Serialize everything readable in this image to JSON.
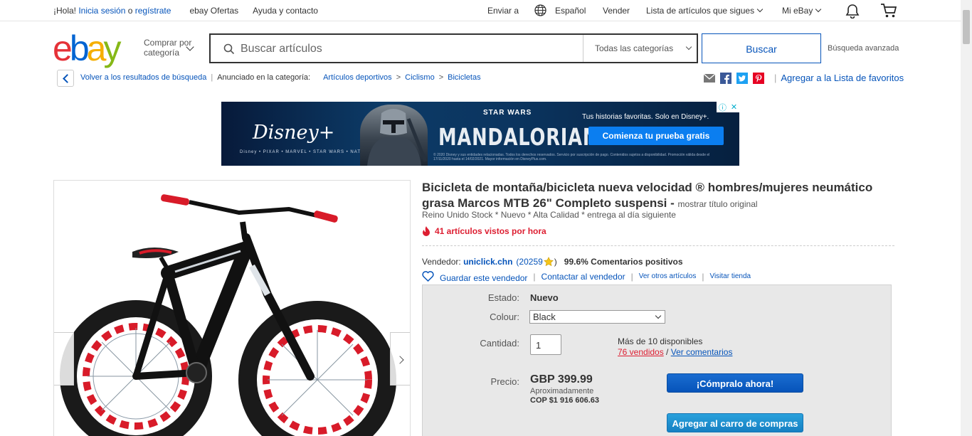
{
  "topbar": {
    "greeting": "¡Hola! ",
    "signin": "Inicia sesión",
    "or": " o ",
    "register": "regístrate",
    "deals": "ebay Ofertas",
    "help": "Ayuda y contacto",
    "ship_to": "Enviar a",
    "language": "Español",
    "sell": "Vender",
    "watchlist": "Lista de artículos que sigues",
    "my_ebay": "Mi eBay"
  },
  "header": {
    "logo": [
      "e",
      "b",
      "a",
      "y"
    ],
    "shop_by_category": [
      "Comprar por",
      "categoría"
    ],
    "search_placeholder": "Buscar artículos",
    "category_select": "Todas las categorías",
    "search_button": "Buscar",
    "advanced": "Búsqueda avanzada"
  },
  "breadcrumb": {
    "back": "Volver a los resultados de búsqueda",
    "listed_in": "Anunciado en la categoría:",
    "items": [
      "Artículos deportivos",
      "Ciclismo",
      "Bicicletas"
    ],
    "add_to_watchlist": "Agregar a la Lista de favoritos"
  },
  "ad": {
    "brand": "Disney+",
    "brands_line": "Disney • PIXAR • MARVEL • STAR WARS • NATIONAL GEOGRAPHIC",
    "starwars": "STAR WARS",
    "show_title": "MANDALORIAN",
    "legal": "© 2020 Disney y sus entidades relacionadas. Todos los derechos reservados. Servicio por suscripción de pago. Contenidos sujetos a disponibilidad. Promoción válida desde el 17/11/2020 hasta el 14/02/2021. Mayor información en DisneyPlus.com.",
    "tagline": "Tus historias favoritas. Solo en Disney+.",
    "cta": "Comienza tu prueba gratis"
  },
  "product": {
    "title": "Bicicleta de montaña/bicicleta nueva velocidad ® hombres/mujeres neumático grasa Marcos MTB 26\" Completo suspensi - ",
    "show_original": "mostrar título original",
    "subtitle": "Reino Unido Stock * Nuevo * Alta Calidad * entrega al día siguiente",
    "watchers": "41 artículos vistos por hora",
    "seller_label": "Vendedor: ",
    "seller_name": "uniclick.chn",
    "seller_score": "(20259",
    "seller_score_close": ")",
    "feedback": "99.6% Comentarios positivos",
    "save_seller": "Guardar este vendedor",
    "contact_seller": "Contactar al vendedor",
    "other_items": "Ver otros artículos",
    "visit_store": "Visitar tienda",
    "condition_label": "Estado:",
    "condition": "Nuevo",
    "colour_label": "Colour:",
    "colour": "Black",
    "quantity_label": "Cantidad:",
    "quantity": "1",
    "available": "Más de 10 disponibles",
    "sold": "76 vendidos",
    "sold_sep": " / ",
    "reviews": "Ver comentarios",
    "price_label": "Precio:",
    "price": "GBP 399.99",
    "approx_label": "Aproximadamente",
    "approx_value": "COP $1 916 606.63",
    "buy_now": "¡Cómpralo ahora!",
    "add_to_cart": "Agregar al carro de compras"
  },
  "colors": {
    "link": "#0654ba",
    "alert": "#dd1e31",
    "buy": "#0654ba",
    "cart": "#1580c3"
  }
}
